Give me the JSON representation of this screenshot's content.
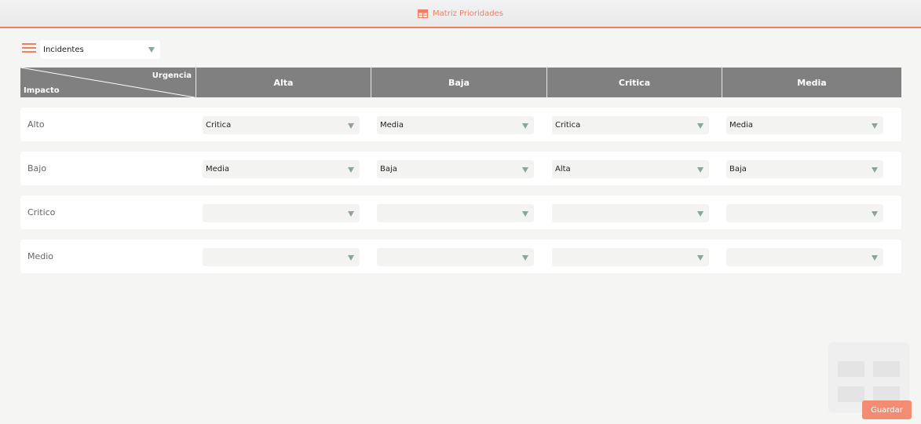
{
  "header": {
    "title": "Matriz Prioridades",
    "icon": "table-icon"
  },
  "toolbar": {
    "menu_icon": "hamburger-menu-icon",
    "selected_type": "Incidentes"
  },
  "matrix": {
    "corner_top": "Urgencia",
    "corner_bottom": "Impacto",
    "columns": [
      "Alta",
      "Baja",
      "Critica",
      "Media"
    ],
    "rows": [
      {
        "label": "Alto",
        "values": [
          "Critica",
          "Media",
          "Critica",
          "Media"
        ]
      },
      {
        "label": "Bajo",
        "values": [
          "Media",
          "Baja",
          "Alta",
          "Baja"
        ]
      },
      {
        "label": "Critico",
        "values": [
          "",
          "",
          "",
          ""
        ]
      },
      {
        "label": "Medio",
        "values": [
          "",
          "",
          "",
          ""
        ]
      }
    ]
  },
  "actions": {
    "save_label": "Guardar"
  },
  "colors": {
    "accent": "#f07f63",
    "header_bg": "#808080",
    "button": "#f28c73"
  }
}
